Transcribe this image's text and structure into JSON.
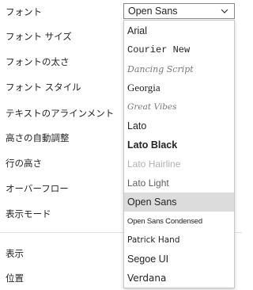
{
  "property_labels": {
    "font": "フォント",
    "font_size": "フォント サイズ",
    "font_weight": "フォントの太さ",
    "font_style": "フォント スタイル",
    "text_alignment": "テキストのアラインメント",
    "auto_height": "高さの自動調整",
    "line_height": "行の高さ",
    "overflow": "オーバーフロー",
    "display_mode": "表示モード",
    "visible": "表示",
    "position": "位置"
  },
  "font_select": {
    "value": "Open Sans",
    "chevron_icon": "chevron-down-icon",
    "border_color": "#8a8886"
  },
  "font_dropdown": {
    "selected_background": "#dcdcdc",
    "options": [
      {
        "label": "Arial"
      },
      {
        "label": "Courier New"
      },
      {
        "label": "Dancing Script"
      },
      {
        "label": "Georgia"
      },
      {
        "label": "Great Vibes"
      },
      {
        "label": "Lato"
      },
      {
        "label": "Lato Black"
      },
      {
        "label": "Lato Hairline"
      },
      {
        "label": "Lato Light"
      },
      {
        "label": "Open Sans",
        "selected": true
      },
      {
        "label": "Open Sans Condensed"
      },
      {
        "label": "Patrick Hand"
      },
      {
        "label": "Segoe UI"
      },
      {
        "label": "Verdana"
      }
    ]
  }
}
